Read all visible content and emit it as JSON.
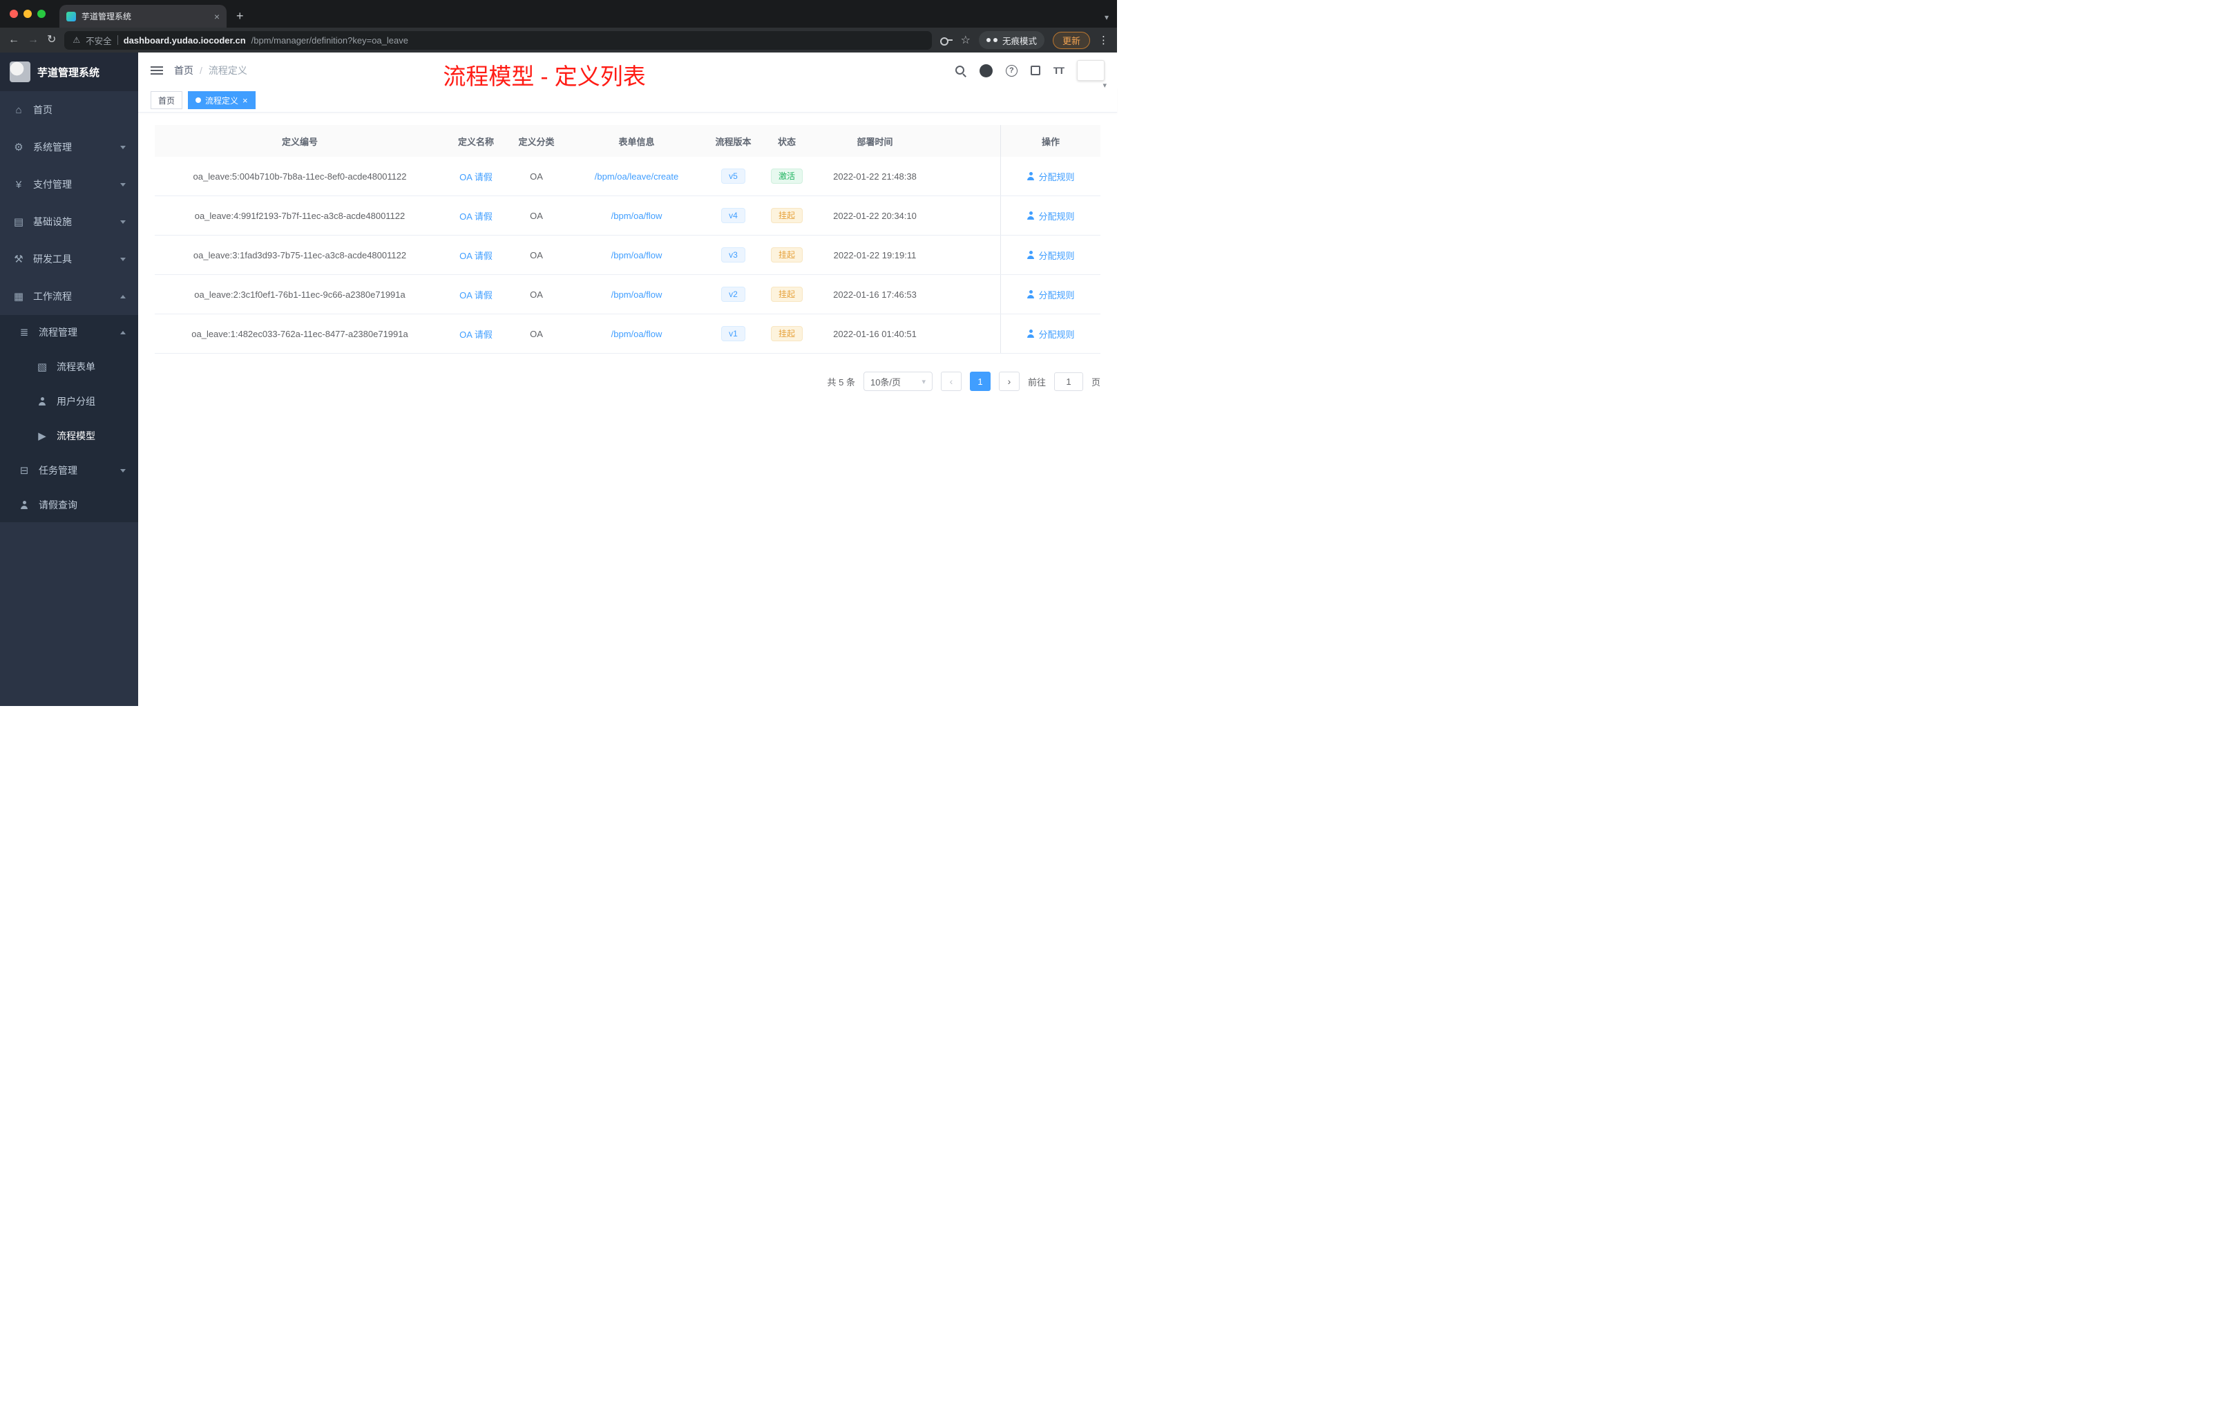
{
  "colors": {
    "accent": "#409eff",
    "success": "#1fb35f",
    "warning": "#e6a23c",
    "annotation_red": "#ff1c15",
    "sidebar_bg": "#2b3445",
    "submenu_bg": "#212a38"
  },
  "icons": {
    "back": "←",
    "forward": "→",
    "reload": "↻",
    "warning": "⚠",
    "star": "☆",
    "dots": "⋮",
    "plus": "+",
    "close": "×",
    "caret_down": "▾",
    "prev": "‹",
    "next": "›",
    "slash": "/",
    "help": "?",
    "font_size": "TT"
  },
  "browser": {
    "tab_title": "芋道管理系统",
    "security_label": "不安全",
    "url_host": "dashboard.yudao.iocoder.cn",
    "url_path": "/bpm/manager/definition?key=oa_leave",
    "incognito_label": "无痕模式",
    "update_label": "更新"
  },
  "sidebar": {
    "app_title": "芋道管理系统",
    "items": [
      {
        "label": "首页",
        "icon": "⌂"
      },
      {
        "label": "系统管理",
        "icon": "⚙"
      },
      {
        "label": "支付管理",
        "icon": "¥"
      },
      {
        "label": "基础设施",
        "icon": "▤"
      },
      {
        "label": "研发工具",
        "icon": "⚒"
      },
      {
        "label": "工作流程",
        "icon": "▦"
      }
    ],
    "workflow_submenu": {
      "group_label": "流程管理",
      "group_icon": "≣",
      "children": [
        {
          "label": "流程表单",
          "icon": "▧"
        },
        {
          "label": "用户分组"
        },
        {
          "label": "流程模型",
          "icon": "▶"
        }
      ],
      "task_label": "任务管理",
      "task_icon": "⊟",
      "leave_label": "请假查询"
    }
  },
  "header": {
    "breadcrumb_home": "首页",
    "breadcrumb_current": "流程定义",
    "annotation": "流程模型 - 定义列表"
  },
  "tags": {
    "home": "首页",
    "active": "流程定义"
  },
  "table": {
    "columns": [
      "定义编号",
      "定义名称",
      "定义分类",
      "表单信息",
      "流程版本",
      "状态",
      "部署时间",
      "操作"
    ],
    "rows": [
      {
        "id": "oa_leave:5:004b710b-7b8a-11ec-8ef0-acde48001122",
        "name": "OA 请假",
        "category": "OA",
        "form": "/bpm/oa/leave/create",
        "version": "v5",
        "status": "激活",
        "status_type": "success",
        "time": "2022-01-22 21:48:38",
        "action": "分配规则"
      },
      {
        "id": "oa_leave:4:991f2193-7b7f-11ec-a3c8-acde48001122",
        "name": "OA 请假",
        "category": "OA",
        "form": "/bpm/oa/flow",
        "version": "v4",
        "status": "挂起",
        "status_type": "warning",
        "time": "2022-01-22 20:34:10",
        "action": "分配规则"
      },
      {
        "id": "oa_leave:3:1fad3d93-7b75-11ec-a3c8-acde48001122",
        "name": "OA 请假",
        "category": "OA",
        "form": "/bpm/oa/flow",
        "version": "v3",
        "status": "挂起",
        "status_type": "warning",
        "time": "2022-01-22 19:19:11",
        "action": "分配规则"
      },
      {
        "id": "oa_leave:2:3c1f0ef1-76b1-11ec-9c66-a2380e71991a",
        "name": "OA 请假",
        "category": "OA",
        "form": "/bpm/oa/flow",
        "version": "v2",
        "status": "挂起",
        "status_type": "warning",
        "time": "2022-01-16 17:46:53",
        "action": "分配规则"
      },
      {
        "id": "oa_leave:1:482ec033-762a-11ec-8477-a2380e71991a",
        "name": "OA 请假",
        "category": "OA",
        "form": "/bpm/oa/flow",
        "version": "v1",
        "status": "挂起",
        "status_type": "warning",
        "time": "2022-01-16 01:40:51",
        "action": "分配规则"
      }
    ]
  },
  "pagination": {
    "total": "共 5 条",
    "page_size": "10条/页",
    "current": "1",
    "goto_label": "前往",
    "goto_value": "1",
    "goto_suffix": "页"
  }
}
